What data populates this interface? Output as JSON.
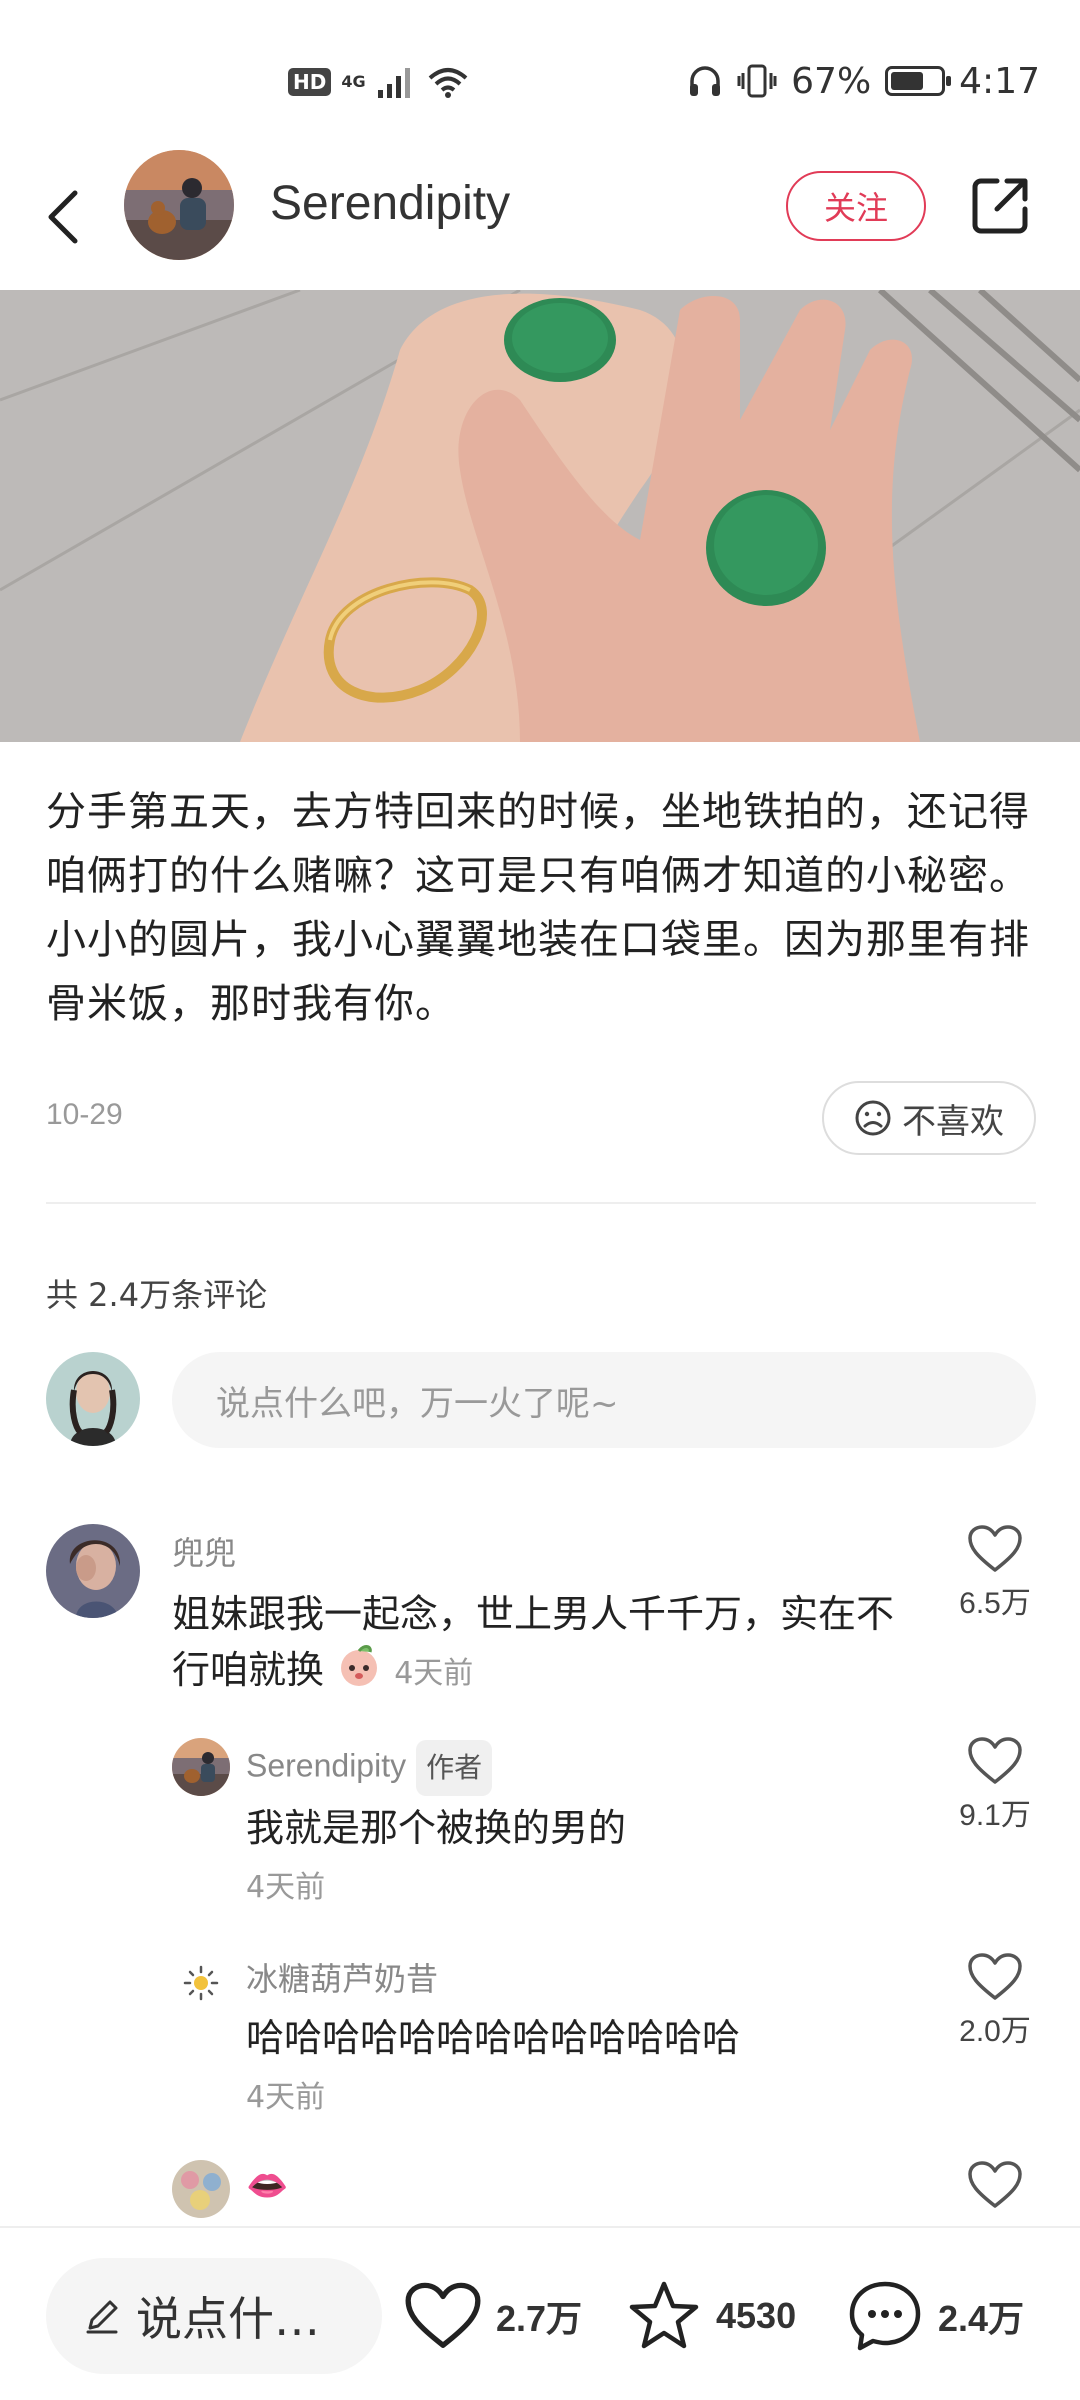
{
  "status_bar": {
    "hd": "HD",
    "network": "4G",
    "battery": "67%",
    "battery_level": 0.67,
    "time": "4:17"
  },
  "header": {
    "author": "Serendipity",
    "follow_label": "关注"
  },
  "post": {
    "text": "分手第五天，去方特回来的时候，坐地铁拍的，还记得咱俩打的什么赌嘛？这可是只有咱俩才知道的小秘密。小小的圆片，我小心翼翼地装在口袋里。因为那里有排骨米饭，那时我有你。",
    "date": "10-29",
    "dislike_label": "不喜欢"
  },
  "comments_section": {
    "count_label": "共 2.4万条评论",
    "input_placeholder": "说点什么吧，万一火了呢~"
  },
  "comments": [
    {
      "name": "兜兜",
      "text": "姐妹跟我一起念，世上男人千千万，实在不行咱就换",
      "time": "4天前",
      "likes": "6.5万"
    },
    {
      "name": "Serendipity",
      "tag": "作者",
      "text": "我就是那个被换的男的",
      "time": "4天前",
      "likes": "9.1万"
    },
    {
      "name": "冰糖葫芦奶昔",
      "text": "哈哈哈哈哈哈哈哈哈哈哈哈哈",
      "time": "4天前",
      "likes": "2.0万"
    },
    {
      "name": "",
      "text": "👄",
      "time": "",
      "likes": ""
    }
  ],
  "bottom_bar": {
    "input_label": "说点什…",
    "like_count": "2.7万",
    "star_count": "4530",
    "comment_count": "2.4万"
  },
  "colors": {
    "accent": "#e13b57",
    "text_primary": "#222222",
    "text_secondary": "#999999"
  }
}
